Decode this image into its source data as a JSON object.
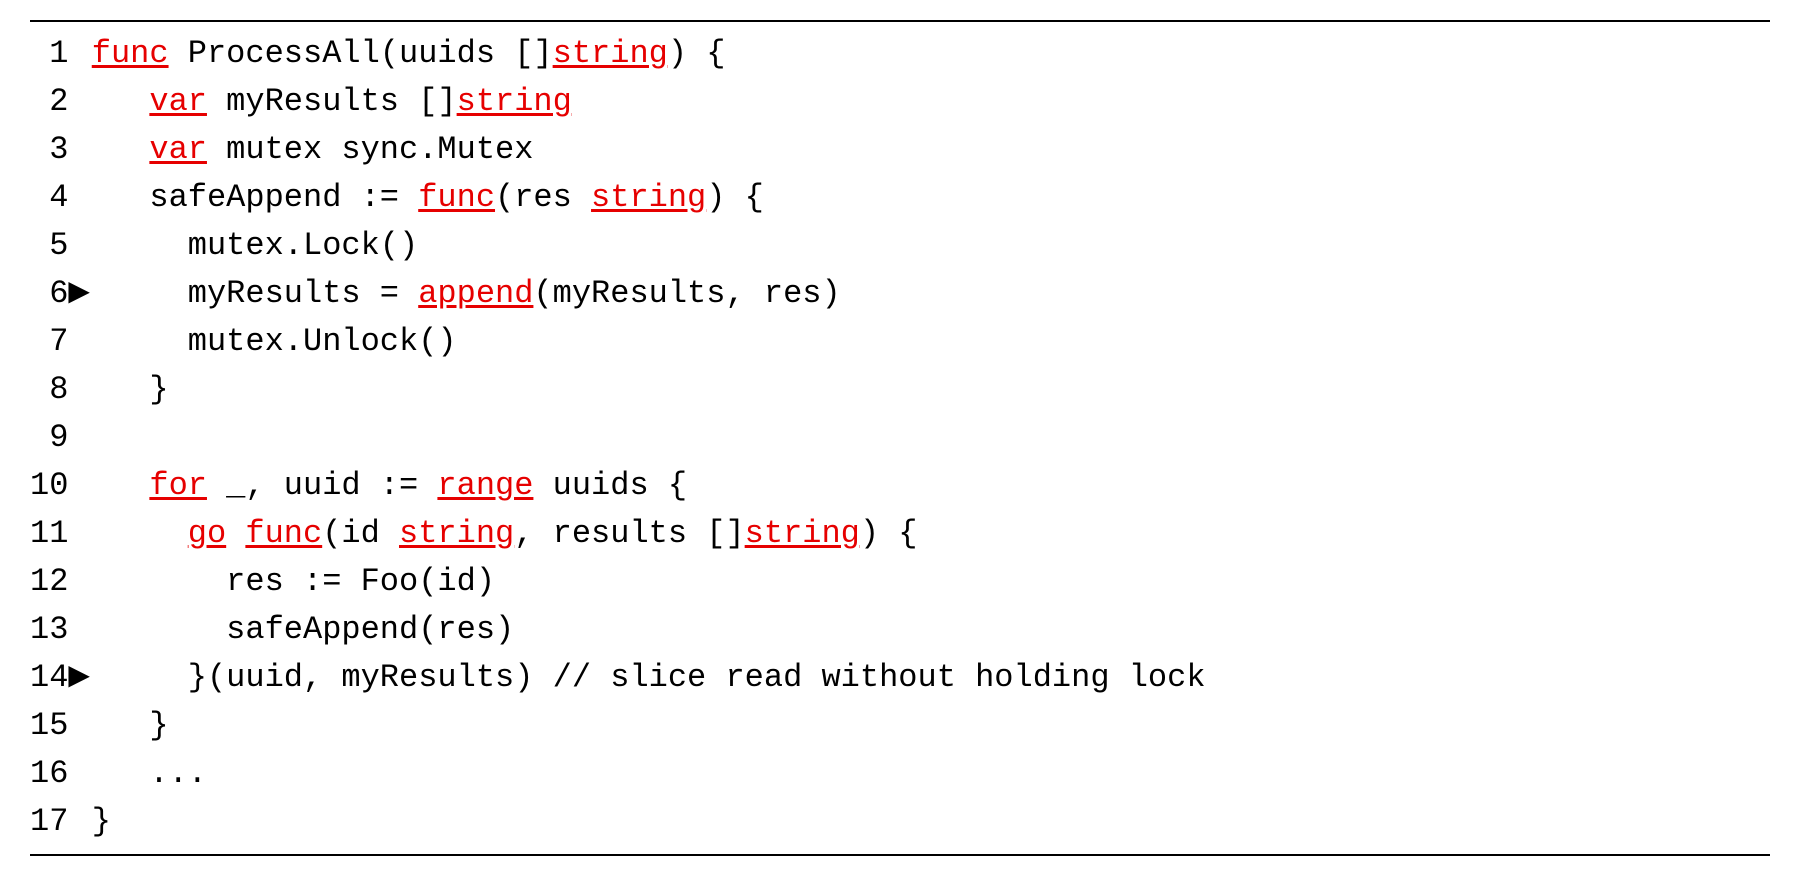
{
  "lines": [
    {
      "n": "1",
      "m": "",
      "segs": [
        [
          "func",
          "kw"
        ],
        [
          " ProcessAll(uuids []",
          ""
        ],
        [
          "string",
          "kw"
        ],
        [
          ") {",
          ""
        ]
      ]
    },
    {
      "n": "2",
      "m": "",
      "segs": [
        [
          "   ",
          ""
        ],
        [
          "var",
          "kw"
        ],
        [
          " myResults []",
          ""
        ],
        [
          "string",
          "kw"
        ]
      ]
    },
    {
      "n": "3",
      "m": "",
      "segs": [
        [
          "   ",
          ""
        ],
        [
          "var",
          "kw"
        ],
        [
          " mutex sync.Mutex",
          ""
        ]
      ]
    },
    {
      "n": "4",
      "m": "",
      "segs": [
        [
          "   safeAppend := ",
          ""
        ],
        [
          "func",
          "kw"
        ],
        [
          "(res ",
          ""
        ],
        [
          "string",
          "kw"
        ],
        [
          ") {",
          ""
        ]
      ]
    },
    {
      "n": "5",
      "m": "",
      "segs": [
        [
          "     mutex.Lock()",
          ""
        ]
      ]
    },
    {
      "n": "6",
      "m": "▶",
      "segs": [
        [
          "     myResults = ",
          ""
        ],
        [
          "append",
          "kw"
        ],
        [
          "(myResults, res)",
          ""
        ]
      ]
    },
    {
      "n": "7",
      "m": "",
      "segs": [
        [
          "     mutex.Unlock()",
          ""
        ]
      ]
    },
    {
      "n": "8",
      "m": "",
      "segs": [
        [
          "   }",
          ""
        ]
      ]
    },
    {
      "n": "9",
      "m": "",
      "segs": [
        [
          "",
          ""
        ]
      ]
    },
    {
      "n": "10",
      "m": "",
      "segs": [
        [
          "   ",
          ""
        ],
        [
          "for",
          "kw"
        ],
        [
          " _, uuid := ",
          ""
        ],
        [
          "range",
          "kw"
        ],
        [
          " uuids {",
          ""
        ]
      ]
    },
    {
      "n": "11",
      "m": "",
      "segs": [
        [
          "     ",
          ""
        ],
        [
          "go",
          "kw"
        ],
        [
          " ",
          ""
        ],
        [
          "func",
          "kw"
        ],
        [
          "(id ",
          ""
        ],
        [
          "string",
          "kw"
        ],
        [
          ", results []",
          ""
        ],
        [
          "string",
          "kw"
        ],
        [
          ") {",
          ""
        ]
      ]
    },
    {
      "n": "12",
      "m": "",
      "segs": [
        [
          "       res := Foo(id)",
          ""
        ]
      ]
    },
    {
      "n": "13",
      "m": "",
      "segs": [
        [
          "       safeAppend(res)",
          ""
        ]
      ]
    },
    {
      "n": "14",
      "m": "▶",
      "segs": [
        [
          "     }(uuid, myResults) // slice read without holding lock",
          ""
        ]
      ]
    },
    {
      "n": "15",
      "m": "",
      "segs": [
        [
          "   }",
          ""
        ]
      ]
    },
    {
      "n": "16",
      "m": "",
      "segs": [
        [
          "   ...",
          ""
        ]
      ]
    },
    {
      "n": "17",
      "m": "",
      "segs": [
        [
          "}",
          ""
        ]
      ]
    }
  ]
}
